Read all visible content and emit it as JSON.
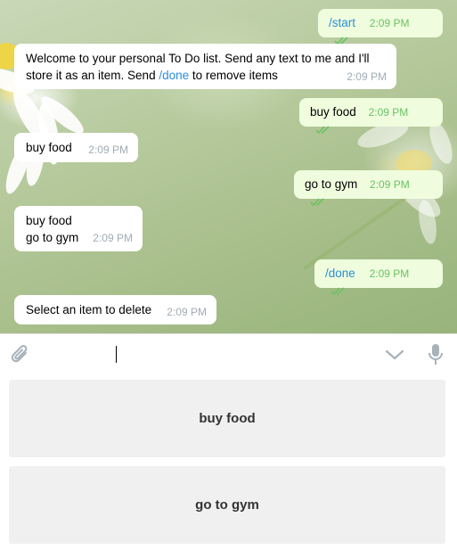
{
  "messages": [
    {
      "dir": "out",
      "cmd": "/start",
      "time": "2:09 PM"
    },
    {
      "dir": "in",
      "line1": "Welcome to your personal To Do list. Send any text to me and I'll",
      "line2_pre": "store it as an item. Send ",
      "line2_cmd": "/done",
      "line2_post": " to remove items",
      "time": "2:09 PM"
    },
    {
      "dir": "out",
      "text": "buy food",
      "time": "2:09 PM"
    },
    {
      "dir": "in",
      "text": "buy food",
      "time": "2:09 PM"
    },
    {
      "dir": "out",
      "text": "go to gym",
      "time": "2:09 PM"
    },
    {
      "dir": "in",
      "line1": "buy food",
      "line2": "go to gym",
      "time": "2:09 PM"
    },
    {
      "dir": "out",
      "cmd": "/done",
      "time": "2:09 PM"
    },
    {
      "dir": "in",
      "text": "Select an item to delete",
      "time": "2:09 PM"
    }
  ],
  "input": {
    "value": "",
    "placeholder": ""
  },
  "icons": {
    "attach": "paperclip-icon",
    "collapse": "chevron-down-icon",
    "voice": "microphone-icon",
    "read": "double-check-icon"
  },
  "keyboard": {
    "buttons": [
      "buy food",
      "go to gym"
    ]
  },
  "colors": {
    "outgoing_bubble": "#effdde",
    "incoming_bubble": "#ffffff",
    "command_link": "#2a8fd6",
    "read_ticks": "#6cc264",
    "keyboard_button": "#f0f0f0"
  }
}
